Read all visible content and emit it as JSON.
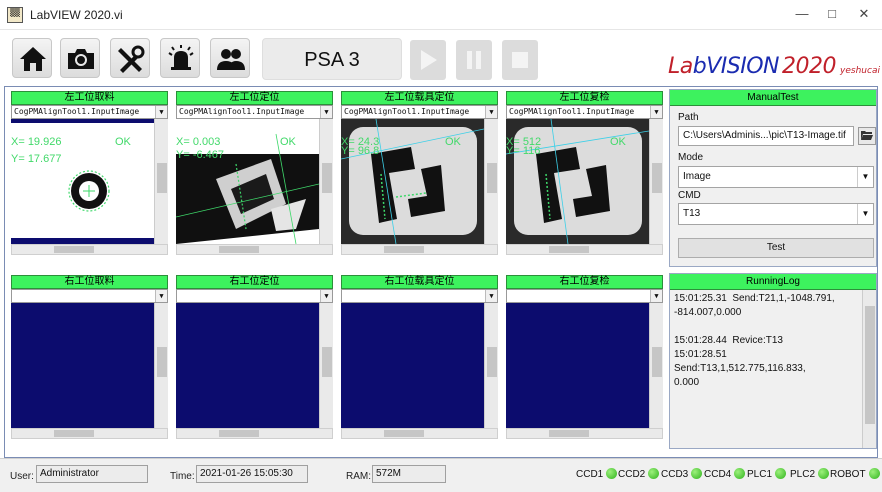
{
  "window": {
    "title": "LabVIEW 2020.vi",
    "icon_text": "▒▒",
    "minimize_icon": "—",
    "maximize_icon": "□",
    "close_icon": "✕"
  },
  "toolbar": {
    "icons": [
      "home-icon",
      "camera-icon",
      "tools-icon",
      "alarm-bell-icon",
      "users-icon"
    ],
    "station_label": "PSA 3",
    "media_icons": [
      "play-icon",
      "pause-icon",
      "stop-icon"
    ],
    "brand_prefix": "L",
    "brand_a": "a",
    "brand_b": "b",
    "brand_vision": "VISION",
    "brand_year": "2020",
    "brand_author": "yeshucai",
    "colors": {
      "brand_red": "#c0202a",
      "brand_blue": "#1a2bb0",
      "accent_green": "#3df25e"
    }
  },
  "cameras": {
    "left_pick": {
      "title": "左工位取料",
      "tool": "CogPMAlignTool1.InputImage",
      "x_text": "X= 19.926",
      "y_text": "Y= 17.677",
      "status": "OK"
    },
    "left_locate": {
      "title": "左工位定位",
      "tool": "CogPMAlignTool1.InputImage",
      "x_text": "X= 0.003",
      "y_text": "Y= -6.467",
      "status": "OK"
    },
    "left_fixture": {
      "title": "左工位载具定位",
      "tool": "CogPMAlignTool1.InputImage",
      "x_text": "X= 24.3",
      "y_text": "Y= 96.8",
      "status": "OK"
    },
    "left_recheck": {
      "title": "左工位复检",
      "tool": "CogPMAlignTool1.InputImage",
      "x_text": "X= 512",
      "y_text": "Y= 116",
      "status": "OK"
    },
    "right_pick": {
      "title": "右工位取料",
      "tool": ""
    },
    "right_locate": {
      "title": "右工位定位",
      "tool": ""
    },
    "right_fixture": {
      "title": "右工位载具定位",
      "tool": ""
    },
    "right_recheck": {
      "title": "右工位复检",
      "tool": ""
    }
  },
  "manual_test": {
    "title": "ManualTest",
    "path_label": "Path",
    "path_value": "C:\\Users\\Adminis...\\pic\\T13-Image.tif",
    "folder_icon": "folder-open-icon",
    "mode_label": "Mode",
    "mode_value": "Image",
    "cmd_label": "CMD",
    "cmd_value": "T13",
    "test_button": "Test"
  },
  "running_log": {
    "title": "RunningLog",
    "text": "15:01:25.31  Send:T21,1,-1048.791,\n-814.007,0.000\n\n15:01:28.44  Revice:T13\n15:01:28.51  Send:T13,1,512.775,116.833,\n0.000"
  },
  "status": {
    "user_label": "User:",
    "user_value": "Administrator",
    "time_label": "Time:",
    "time_value": "2021-01-26 15:05:30",
    "ram_label": "RAM:",
    "ram_value": "572M",
    "indicators": [
      "CCD1",
      "CCD2",
      "CCD3",
      "CCD4",
      "PLC1",
      "PLC2",
      "ROBOT"
    ]
  }
}
